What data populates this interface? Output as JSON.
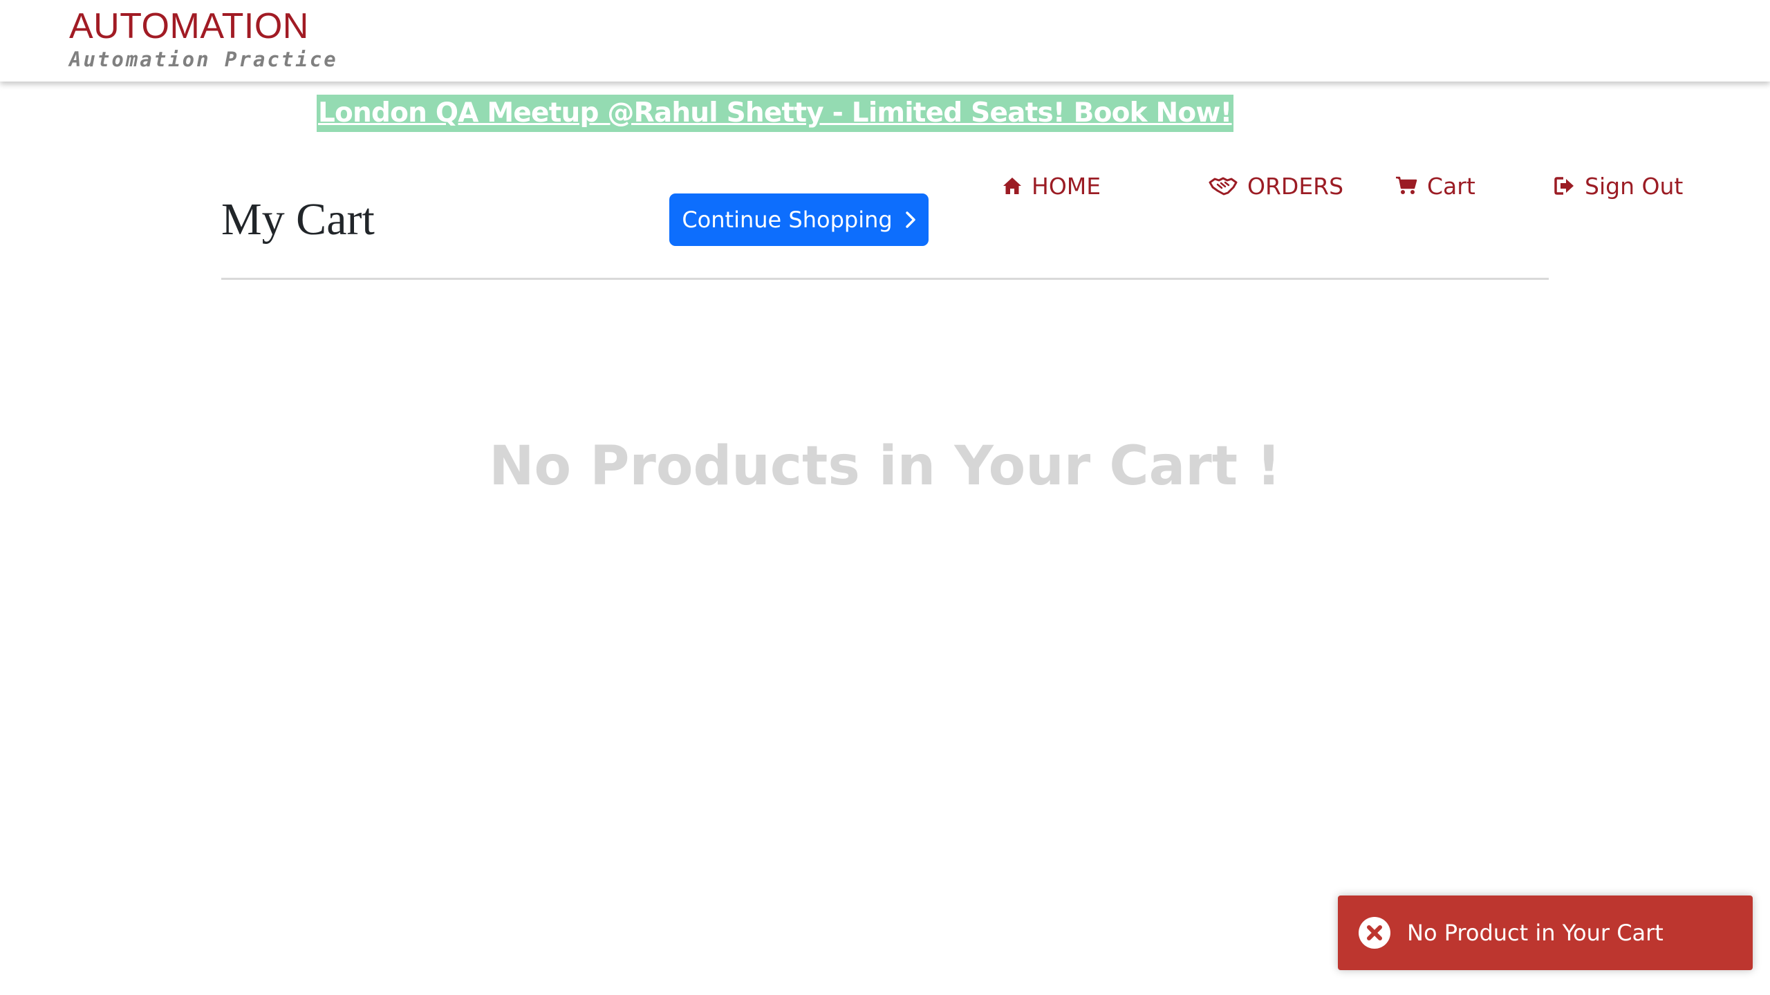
{
  "header": {
    "brand_title": "AUTOMATION",
    "brand_subtitle": "Automation Practice"
  },
  "promo": {
    "text": "London QA Meetup @Rahul Shetty - Limited Seats! Book Now!"
  },
  "nav": {
    "home": "HOME",
    "orders": "ORDERS",
    "cart": "Cart",
    "sign_out": "Sign Out"
  },
  "main": {
    "title": "My Cart",
    "continue_button": "Continue Shopping",
    "empty_message": "No Products in Your Cart !"
  },
  "toast": {
    "message": "No Product in Your Cart",
    "icon": "close-circle-icon"
  },
  "colors": {
    "brand": "#a11b24",
    "nav": "#9b1c24",
    "primary_button": "#0d6efd",
    "promo_bg": "#94dbb2",
    "toast_bg": "#bd362f",
    "empty_text": "#d6d6d6"
  },
  "icons": {
    "home": "home-icon",
    "orders": "handshake-icon",
    "cart": "cart-icon",
    "sign_out": "sign-out-icon",
    "continue": "chevron-right-icon"
  }
}
